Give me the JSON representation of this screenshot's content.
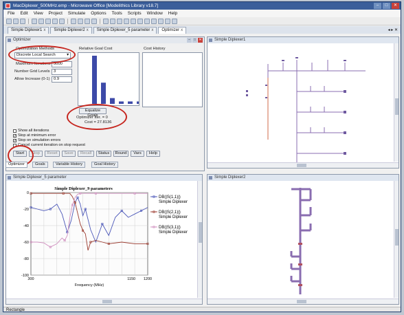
{
  "window": {
    "title": "MacDiplexer_500MHz.emp - Microwave Office [Modelithics Library v18.7]",
    "min": "–",
    "max": "□",
    "close": "✕"
  },
  "menu": [
    "File",
    "Edit",
    "View",
    "Project",
    "Simulate",
    "Options",
    "Tools",
    "Scripts",
    "Window",
    "Help"
  ],
  "doc_tabs": [
    {
      "label": "Simple Diplexer1",
      "active": false
    },
    {
      "label": "Simple Diplexer2",
      "active": false
    },
    {
      "label": "Simple Diplexer_5 parameter",
      "active": false
    },
    {
      "label": "Optimizer",
      "active": true
    }
  ],
  "doc_tab_close": "x",
  "doc_tabs_ctl": "◂ ▸ ✕",
  "optimizer": {
    "title": "Optimizer",
    "method_label": "Optimization Methods",
    "method_value": "Discrete Local Search",
    "max_iter_label": "Maximum Iterations",
    "max_iter_value": "5000",
    "grid_label": "Number Grid Levels",
    "grid_value": "3",
    "allow_label": "Allow Increase (0-1)",
    "allow_value": "0.9",
    "rgc_label": "Relative Goal Cost",
    "cost_history_label": "Cost History",
    "equalize_label": "Equalize Goals",
    "opt_iter_text": "Optimizer Iter. = 0",
    "cost_text": "Cost = 27.8136",
    "checkboxes": [
      {
        "label": "Show all iterations",
        "checked": false
      },
      {
        "label": "Stop at minimum error",
        "checked": true
      },
      {
        "label": "Stop on simulation errors",
        "checked": true
      },
      {
        "label": "Cancel current iteration on stop request",
        "checked": false
      }
    ],
    "buttons": [
      {
        "label": "Start",
        "enabled": true
      },
      {
        "label": "Stop",
        "enabled": false
      },
      {
        "label": "Reset",
        "enabled": false
      },
      {
        "label": "Save",
        "enabled": false
      },
      {
        "label": "Recall",
        "enabled": false
      },
      {
        "label": "Status",
        "enabled": true
      },
      {
        "label": "Round",
        "enabled": true
      },
      {
        "label": "Vars",
        "enabled": true
      },
      {
        "label": "Help",
        "enabled": true
      }
    ],
    "bottom_tabs": [
      "Optimizer",
      "Goals",
      "Variable History",
      "Goal History"
    ],
    "rgc_bars": [
      1.0,
      0.44,
      0.12,
      0.05,
      0.05,
      0.05
    ]
  },
  "panes": {
    "layout1_title": "Simple Diplexer1",
    "graph_title": "Simple Diplexer_5 parameter",
    "layout2_title": "Simple Diplexer2",
    "pane_ctl": {
      "min": "–",
      "max": "□",
      "close": "✕"
    }
  },
  "chart_data": {
    "type": "line",
    "title": "Simple Diplexer_9 parameters",
    "xlabel": "Frequency (MHz)",
    "ylabel": "",
    "xlim": [
      300,
      1200
    ],
    "ylim": [
      -100,
      0
    ],
    "x_ticks": [
      "300",
      "1150",
      "1200"
    ],
    "y_ticks": [
      "0",
      "-20",
      "-40",
      "-60",
      "-80",
      "-100"
    ],
    "grid": true,
    "legend_position": "top-right",
    "series": [
      {
        "name": "DB(|S(1,1)|)",
        "name2": "Simple Diplexer",
        "color": "#4a56b8",
        "dash": "",
        "x": [
          300,
          350,
          400,
          450,
          500,
          540,
          580,
          610,
          640,
          660,
          680,
          700,
          720,
          760,
          800,
          850,
          900,
          950,
          1000,
          1050,
          1100,
          1150,
          1200
        ],
        "y": [
          -18,
          -20,
          -22,
          -20,
          -14,
          -26,
          -48,
          -34,
          -12,
          -6,
          -14,
          -28,
          -20,
          -45,
          -60,
          -38,
          -52,
          -30,
          -22,
          -30,
          -26,
          -22,
          -18
        ]
      },
      {
        "name": "DB(|S(2,1)|)",
        "name2": "Simple Diplexer",
        "color": "#9b3a2e",
        "dash": "",
        "x": [
          300,
          400,
          500,
          550,
          600,
          620,
          640,
          660,
          680,
          700,
          720,
          740,
          760,
          800,
          850,
          900,
          1000,
          1100,
          1200
        ],
        "y": [
          -1,
          -1,
          -1,
          -1,
          -1,
          -5,
          -12,
          -25,
          -38,
          -46,
          -50,
          -70,
          -60,
          -58,
          -60,
          -62,
          -60,
          -62,
          -62
        ]
      },
      {
        "name": "DB(|S(3,1)|)",
        "name2": "Simple Diplexer",
        "color": "#d08fbf",
        "dash": "",
        "x": [
          300,
          350,
          400,
          450,
          500,
          540,
          560,
          580,
          600,
          620,
          640,
          660,
          680,
          700,
          760,
          800,
          900,
          1000,
          1100,
          1200
        ],
        "y": [
          -60,
          -60,
          -61,
          -66,
          -62,
          -55,
          -58,
          -52,
          -30,
          -15,
          -6,
          -2,
          -1,
          -1,
          -1,
          -1,
          -1,
          -1,
          -1,
          -1
        ]
      }
    ],
    "colors": {
      "s11": "#4a56b8",
      "s21": "#9b3a2e",
      "s31": "#d08fbf"
    }
  },
  "status": "Rectangle"
}
